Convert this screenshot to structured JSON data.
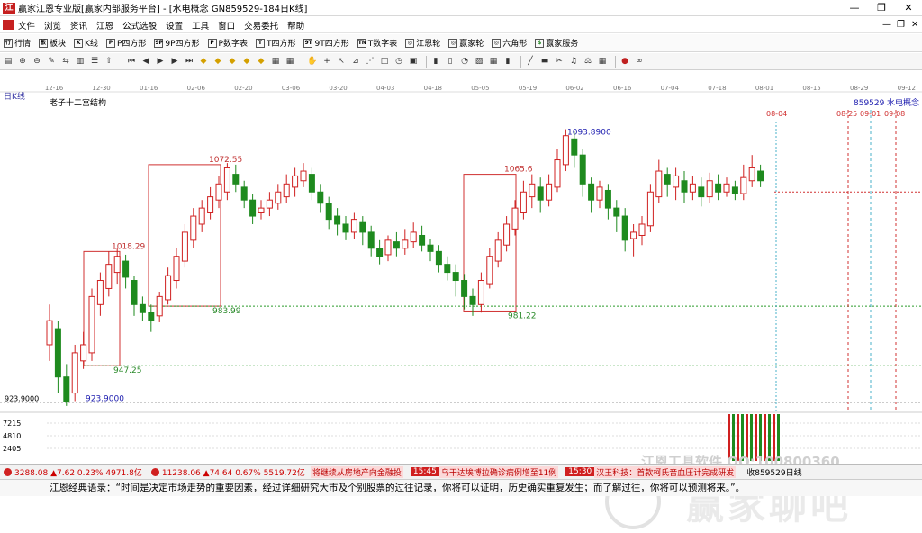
{
  "window": {
    "title": "赢家江恩专业版[赢家内部服务平台] - [水电概念  GN859529-184日K线]",
    "logo_text": "江"
  },
  "menu": [
    "文件",
    "浏览",
    "资讯",
    "江恩",
    "公式选股",
    "设置",
    "工具",
    "窗口",
    "交易委托",
    "帮助"
  ],
  "tabs": [
    {
      "icon": "行",
      "label": "行情"
    },
    {
      "icon": "板",
      "label": "板块"
    },
    {
      "icon": "K",
      "label": "K线"
    },
    {
      "icon": "P",
      "label": "P四方形"
    },
    {
      "icon": "9P",
      "label": "9P四方形"
    },
    {
      "icon": "P",
      "label": "P数字表"
    },
    {
      "icon": "T",
      "label": "T四方形"
    },
    {
      "icon": "9T",
      "label": "9T四方形"
    },
    {
      "icon": "TN",
      "label": "T数字表"
    },
    {
      "icon": "◎",
      "label": "江恩轮"
    },
    {
      "icon": "◎",
      "label": "赢家轮"
    },
    {
      "icon": "◎",
      "label": "六角形"
    },
    {
      "icon": "$",
      "label": "赢家服务"
    }
  ],
  "toolbar_icons": [
    "chart-type-icon",
    "zoom-in-icon",
    "zoom-out-icon",
    "pen-icon",
    "split-icon",
    "bars-icon",
    "list-icon",
    "arrow-up-icon",
    "first-icon",
    "prev-icon",
    "play-icon",
    "next-icon",
    "last-icon",
    "diamond-icon",
    "diamond-icon",
    "diamond-icon",
    "diamond-icon",
    "diamond-icon",
    "grid-icon",
    "grid-icon",
    "hand-icon",
    "cross-icon",
    "cursor-icon",
    "gann-icon",
    "fan-icon",
    "box-icon",
    "cycle-icon",
    "calc-icon",
    "book-icon",
    "doc-icon",
    "pie-icon",
    "chart-icon",
    "calendar-icon",
    "book-icon",
    "line-icon",
    "ruler-icon",
    "scissor-icon",
    "tune-icon",
    "scale-icon",
    "grid-icon",
    "color-icon",
    "link-icon"
  ],
  "chart_data": {
    "type": "candlestick",
    "title": "老子十二宫结构",
    "period_label": "日K线",
    "code": "859529",
    "name": "水电概念",
    "x_ticks": [
      "12-16",
      "12-30",
      "01-16",
      "02-06",
      "02-20",
      "03-06",
      "03-20",
      "04-03",
      "04-18",
      "05-05",
      "05-19",
      "06-02",
      "06-16",
      "07-04",
      "07-18",
      "08-01",
      "08-15",
      "08-29",
      "09-12"
    ],
    "y_min_label": "923.9000",
    "series_note": "approximate daily candles read from chart",
    "candles": [
      [
        960,
        975,
        950,
        985
      ],
      [
        970,
        940,
        930,
        975
      ],
      [
        940,
        925,
        922,
        948
      ],
      [
        930,
        955,
        925,
        960
      ],
      [
        950,
        960,
        945,
        968
      ],
      [
        955,
        990,
        950,
        995
      ],
      [
        985,
        1000,
        978,
        1005
      ],
      [
        995,
        1010,
        990,
        1018
      ],
      [
        1005,
        1015,
        998,
        1020
      ],
      [
        1012,
        1002,
        995,
        1016
      ],
      [
        1000,
        985,
        978,
        1003
      ],
      [
        985,
        980,
        975,
        990
      ],
      [
        980,
        975,
        968,
        985
      ],
      [
        978,
        990,
        974,
        993
      ],
      [
        988,
        1003,
        985,
        1008
      ],
      [
        1000,
        1015,
        995,
        1020
      ],
      [
        1012,
        1030,
        1008,
        1035
      ],
      [
        1025,
        1040,
        1020,
        1045
      ],
      [
        1035,
        1045,
        1030,
        1050
      ],
      [
        1042,
        1052,
        1038,
        1058
      ],
      [
        1050,
        1060,
        1045,
        1065
      ],
      [
        1055,
        1070,
        1050,
        1073
      ],
      [
        1066,
        1060,
        1055,
        1072
      ],
      [
        1058,
        1050,
        1045,
        1062
      ],
      [
        1050,
        1040,
        1035,
        1054
      ],
      [
        1042,
        1045,
        1038,
        1050
      ],
      [
        1045,
        1050,
        1040,
        1055
      ],
      [
        1048,
        1055,
        1044,
        1060
      ],
      [
        1052,
        1060,
        1048,
        1066
      ],
      [
        1058,
        1065,
        1052,
        1070
      ],
      [
        1062,
        1068,
        1058,
        1073
      ],
      [
        1066,
        1055,
        1050,
        1070
      ],
      [
        1055,
        1048,
        1042,
        1060
      ],
      [
        1048,
        1038,
        1032,
        1052
      ],
      [
        1040,
        1035,
        1028,
        1045
      ],
      [
        1035,
        1030,
        1025,
        1040
      ],
      [
        1030,
        1038,
        1026,
        1042
      ],
      [
        1036,
        1030,
        1022,
        1040
      ],
      [
        1030,
        1020,
        1015,
        1034
      ],
      [
        1020,
        1015,
        1010,
        1025
      ],
      [
        1016,
        1025,
        1012,
        1028
      ],
      [
        1024,
        1020,
        1015,
        1030
      ],
      [
        1020,
        1025,
        1016,
        1032
      ],
      [
        1024,
        1030,
        1020,
        1036
      ],
      [
        1028,
        1022,
        1018,
        1034
      ],
      [
        1022,
        1018,
        1012,
        1026
      ],
      [
        1018,
        1010,
        1005,
        1022
      ],
      [
        1010,
        1005,
        1000,
        1015
      ],
      [
        1005,
        1000,
        990,
        1010
      ],
      [
        1000,
        990,
        982,
        1004
      ],
      [
        990,
        985,
        978,
        995
      ],
      [
        985,
        1000,
        980,
        1005
      ],
      [
        998,
        1015,
        995,
        1020
      ],
      [
        1012,
        1025,
        1008,
        1030
      ],
      [
        1022,
        1035,
        1018,
        1040
      ],
      [
        1032,
        1045,
        1028,
        1050
      ],
      [
        1042,
        1055,
        1038,
        1062
      ],
      [
        1052,
        1060,
        1045,
        1066
      ],
      [
        1058,
        1050,
        1042,
        1064
      ],
      [
        1050,
        1060,
        1046,
        1066
      ],
      [
        1058,
        1075,
        1055,
        1082
      ],
      [
        1072,
        1090,
        1068,
        1094
      ],
      [
        1088,
        1078,
        1070,
        1093
      ],
      [
        1078,
        1060,
        1052,
        1082
      ],
      [
        1060,
        1050,
        1042,
        1064
      ],
      [
        1050,
        1058,
        1045,
        1062
      ],
      [
        1056,
        1045,
        1038,
        1060
      ],
      [
        1045,
        1040,
        1030,
        1050
      ],
      [
        1040,
        1025,
        1018,
        1045
      ],
      [
        1026,
        1030,
        1015,
        1035
      ],
      [
        1028,
        1035,
        1022,
        1040
      ],
      [
        1034,
        1055,
        1030,
        1060
      ],
      [
        1052,
        1068,
        1048,
        1075
      ],
      [
        1066,
        1060,
        1052,
        1070
      ],
      [
        1058,
        1065,
        1050,
        1070
      ],
      [
        1062,
        1055,
        1048,
        1068
      ],
      [
        1055,
        1060,
        1050,
        1065
      ],
      [
        1058,
        1052,
        1046,
        1064
      ],
      [
        1052,
        1062,
        1048,
        1067
      ],
      [
        1060,
        1055,
        1050,
        1066
      ],
      [
        1055,
        1060,
        1052,
        1064
      ],
      [
        1058,
        1054,
        1050,
        1062
      ],
      [
        1054,
        1064,
        1050,
        1072
      ],
      [
        1062,
        1070,
        1058,
        1078
      ],
      [
        1068,
        1062,
        1058,
        1072
      ]
    ],
    "volume": [
      7215,
      4810,
      2405
    ],
    "annotations": [
      {
        "label": "1018.29",
        "color": "#c03030"
      },
      {
        "label": "947.25",
        "color": "#2a8a2a"
      },
      {
        "label": "1072.55",
        "color": "#c03030"
      },
      {
        "label": "983.99",
        "color": "#2a8a2a"
      },
      {
        "label": "1065.6",
        "color": "#c03030"
      },
      {
        "label": "981.22",
        "color": "#2a8a2a"
      },
      {
        "label": "1093.8900",
        "color": "#2020b0"
      },
      {
        "label": "923.9000",
        "color": "#2020b0"
      }
    ],
    "date_marks": [
      "08-04",
      "08-25",
      "09-01",
      "09-08"
    ],
    "volume_ticks": [
      "7215",
      "4810",
      "2405"
    ],
    "y_low_label": "923.9000"
  },
  "status": {
    "idx1": "3288.08 ▲7.62 0.23% 4971.8亿",
    "idx2": "11238.06 ▲74.64 0.67% 5519.72亿",
    "news1": "将继续从房地产向金融投",
    "time1": "15:45",
    "news2": "乌干达埃博拉确诊病例增至11例",
    "time2": "15:30",
    "news3": "汉王科技：首款柯氏音血压计完成研发",
    "right": "收859529日线"
  },
  "quote": "江恩经典语录：“时间是决定市场走势的重要因素，经过详细研究大市及个别股票的过往记录，你将可以证明，历史确实重复发生；而了解过往，你将可以预测将来。”。",
  "watermark": {
    "top": "江恩工具软件   QQ:100800360",
    "big": "赢家聊吧"
  },
  "colors": {
    "up": "#d02020",
    "down": "#1e8a1e",
    "box": "#d03030",
    "dash_green": "#2a9a2a",
    "dash_cyan": "#4ab0c8"
  }
}
